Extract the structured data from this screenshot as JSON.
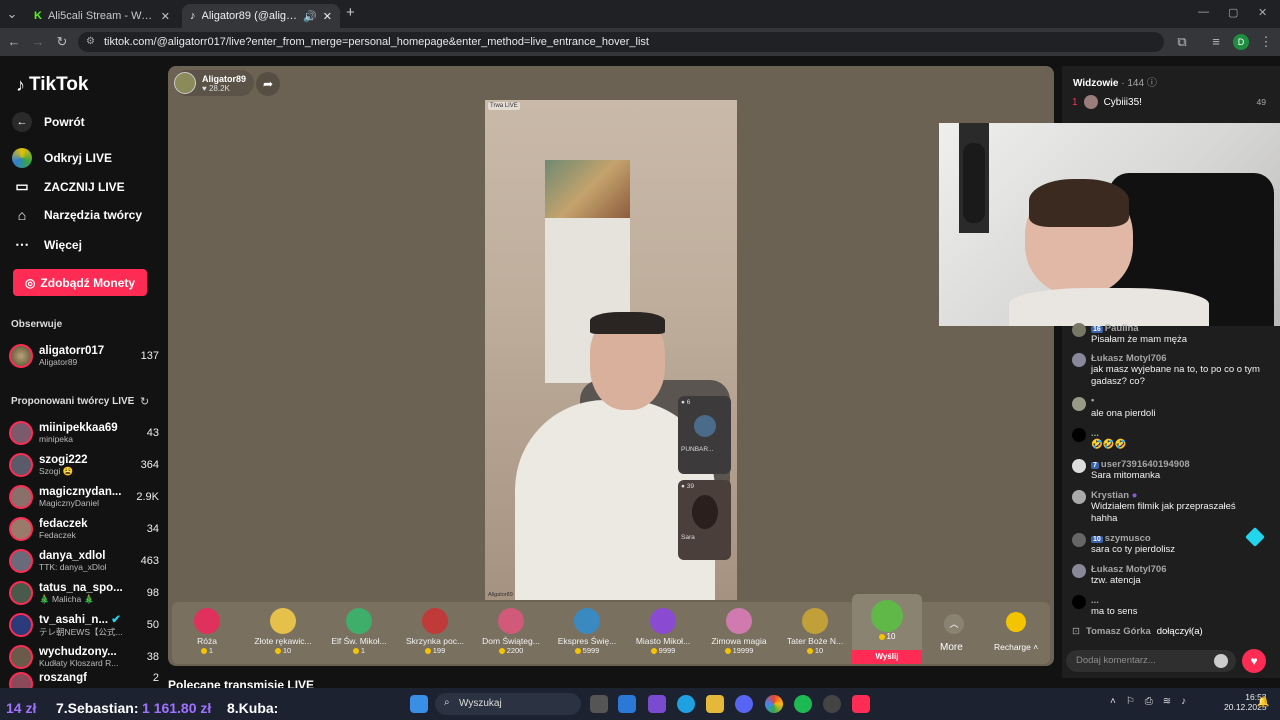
{
  "browser": {
    "tabs": [
      {
        "title": "Ali5cali Stream - Watch Live on"
      },
      {
        "title": "Aligator89 (@aligatorr017)"
      }
    ],
    "new_tab": "+",
    "url": "tiktok.com/@aligatorr017/live?enter_from_merge=personal_homepage&enter_method=live_entrance_hover_list",
    "profile_initial": "D"
  },
  "sidebar": {
    "logo": "TikTok",
    "nav": [
      {
        "label": "Powrót",
        "icon": "back-arrow-icon"
      },
      {
        "label": "Odkryj LIVE",
        "icon": "live-icon"
      },
      {
        "label": "ZACZNIJ LIVE",
        "icon": "camera-icon"
      },
      {
        "label": "Narzędzia twórcy",
        "icon": "home-icon"
      },
      {
        "label": "Więcej",
        "icon": "more-icon"
      }
    ],
    "coins_button": "Zdobądź Monety",
    "following_header": "Obserwuje",
    "following": [
      {
        "name": "aligatorr017",
        "sub": "Aligator89",
        "count": "137"
      }
    ],
    "suggested_header": "Proponowani twórcy LIVE",
    "suggested": [
      {
        "name": "miinipekkaa69",
        "sub": "minipeka",
        "count": "43"
      },
      {
        "name": "szogi222",
        "sub": "Szogi 😩",
        "count": "364"
      },
      {
        "name": "magicznydan...",
        "sub": "MagicznyDaniel",
        "count": "2.9K"
      },
      {
        "name": "fedaczek",
        "sub": "Fedaczek",
        "count": "34"
      },
      {
        "name": "danya_xdlol",
        "sub": "TTK: danya_xDlol",
        "count": "463"
      },
      {
        "name": "tatus_na_spo...",
        "sub": "🎄 Malicha 🎄",
        "count": "98"
      },
      {
        "name": "tv_asahi_n...",
        "sub": "テレ朝NEWS【公式...",
        "count": "50"
      },
      {
        "name": "wychudzony...",
        "sub": "Kudłaty Kloszard R...",
        "count": "38"
      },
      {
        "name": "roszangf",
        "sub": "",
        "count": "2"
      }
    ]
  },
  "player": {
    "host_name": "Aligator89",
    "host_likes": "28.2K",
    "video_tag": "Trwa LIVE",
    "video_watermark": "Aligator89",
    "guests": [
      {
        "count": "6",
        "name": "PUNBAR..."
      },
      {
        "count": "39",
        "name": "Sara"
      }
    ]
  },
  "gifts": [
    {
      "name": "Róża",
      "price": "1"
    },
    {
      "name": "Złote rękawic...",
      "price": "10"
    },
    {
      "name": "Elf Św. Mikoł...",
      "price": "1"
    },
    {
      "name": "Skrzynka poc...",
      "price": "199"
    },
    {
      "name": "Dom Świąteg...",
      "price": "2200"
    },
    {
      "name": "Ekspres Świę...",
      "price": "5999"
    },
    {
      "name": "Miasto Mikoł...",
      "price": "9999"
    },
    {
      "name": "Zimowa magia",
      "price": "19999"
    },
    {
      "name": "Tater Boże N...",
      "price": "10"
    }
  ],
  "featured_gift": {
    "price": "10",
    "send_label": "Wyślij"
  },
  "more_label": "More",
  "recharge_label": "Recharge",
  "below_player_heading": "Polecane transmisje LIVE",
  "chat": {
    "viewers_label": "Widzowie",
    "viewers_count": "144",
    "top_viewer": {
      "rank": "1",
      "name": "Cybiii35!",
      "score": "49"
    },
    "messages": [
      {
        "user": "Paulina",
        "level": "16",
        "text": "Pisałam że mam męża"
      },
      {
        "user": "Łukasz Motyl706",
        "level": "",
        "text": "jak masz wyjebane na to, to po co o tym gadasz? co?"
      },
      {
        "user": "",
        "level": "",
        "text": "ale ona pierdoli"
      },
      {
        "user": "...",
        "level": "",
        "text": "🤣🤣🤣"
      },
      {
        "user": "user7391640194908",
        "level": "7",
        "text": "Sara mitomanka"
      },
      {
        "user": "Krystian",
        "level": "",
        "text": "Widziałem filmik jak przepraszałeś hahha"
      },
      {
        "user": "szymusco",
        "level": "10",
        "text": "sara co ty pierdolisz"
      },
      {
        "user": "Łukasz Motyl706",
        "level": "",
        "text": "tzw. atencja"
      },
      {
        "user": "...",
        "level": "",
        "text": "ma to sens"
      }
    ],
    "join": {
      "user": "Tomasz Górka",
      "text": "dołączył(a)"
    },
    "input_placeholder": "Dodaj komentarz..."
  },
  "overlay_ticker": {
    "left": "14 zł",
    "entry": "7.Sebastian:",
    "amount": "1 161.80 zł",
    "next": "8.Kuba:"
  },
  "taskbar": {
    "search_placeholder": "Wyszukaj",
    "time": "16:53",
    "date": "20.12.2025"
  }
}
